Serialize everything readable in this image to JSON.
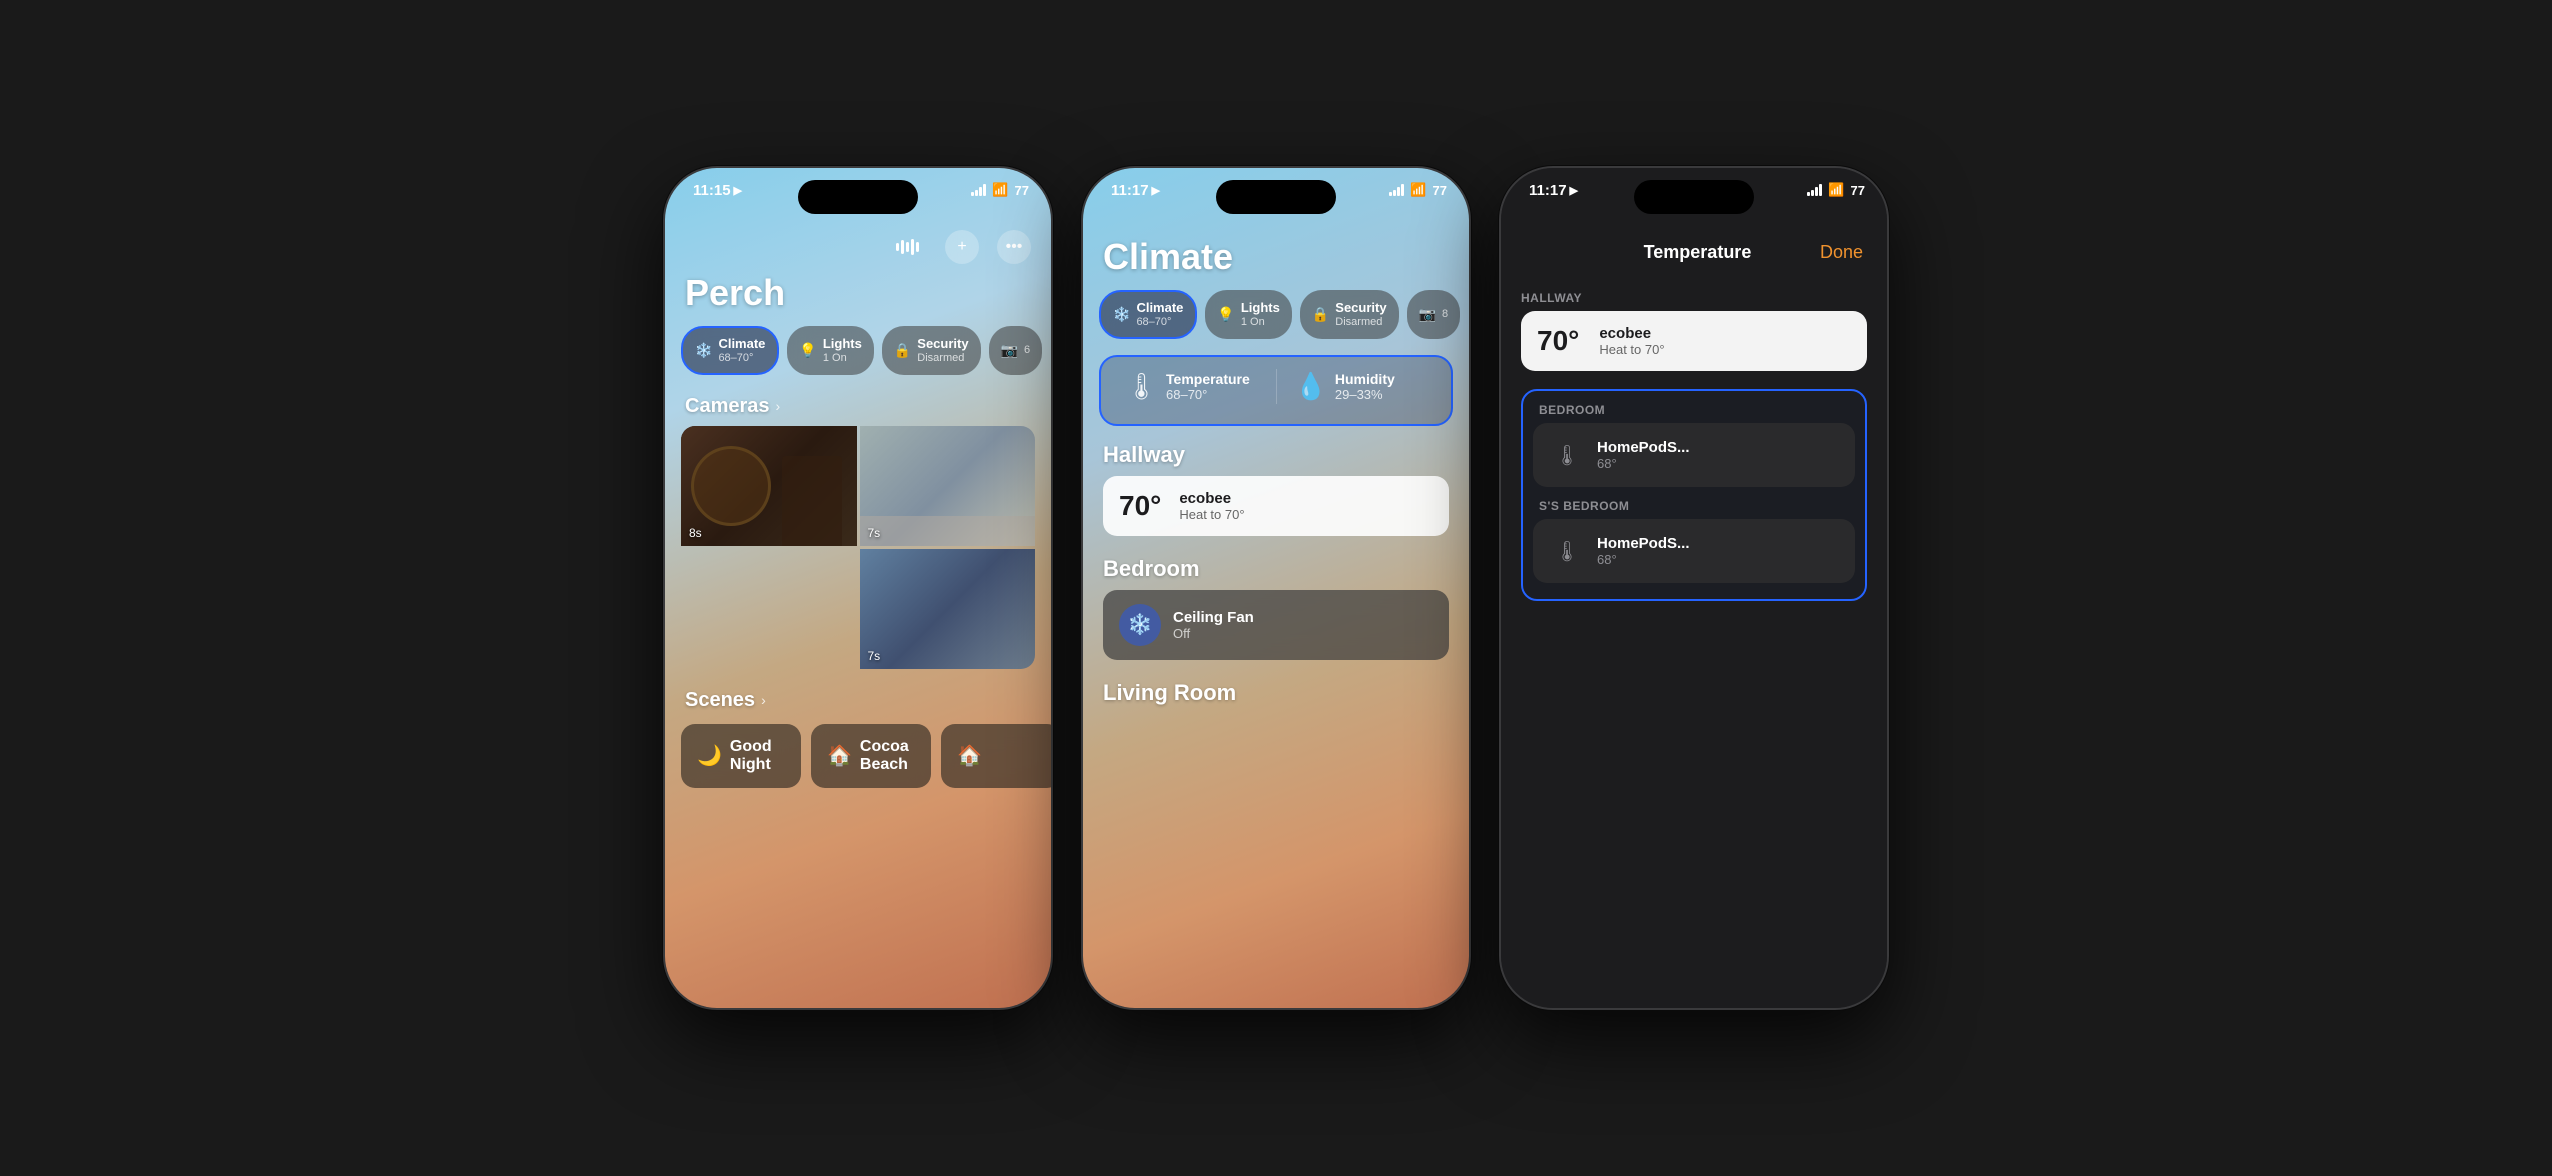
{
  "phone1": {
    "status_time": "11:15",
    "title": "Perch",
    "tabs": [
      {
        "label": "Climate",
        "sublabel": "68–70°",
        "icon": "❄️",
        "active": true
      },
      {
        "label": "Lights",
        "sublabel": "1 On",
        "icon": "💡",
        "active": false
      },
      {
        "label": "Security",
        "sublabel": "Disarmed",
        "icon": "🔒",
        "active": false
      },
      {
        "label": "",
        "sublabel": "6",
        "icon": "📷",
        "active": false
      }
    ],
    "cameras_label": "Cameras",
    "cameras": [
      {
        "timer": "8s"
      },
      {
        "timer": "7s"
      },
      {
        "timer": "7s"
      },
      {
        "timer": ""
      }
    ],
    "scenes_label": "Scenes",
    "scenes": [
      {
        "label": "Good Night",
        "icon": "🌙"
      },
      {
        "label": "Cocoa Beach",
        "icon": "🏠"
      }
    ]
  },
  "phone2": {
    "status_time": "11:17",
    "title": "Climate",
    "tabs": [
      {
        "label": "Climate",
        "sublabel": "68–70°",
        "icon": "❄️",
        "active": true
      },
      {
        "label": "Lights",
        "sublabel": "1 On",
        "icon": "💡",
        "active": false
      },
      {
        "label": "Security",
        "sublabel": "Disarmed",
        "icon": "🔒",
        "active": false
      },
      {
        "label": "",
        "sublabel": "8",
        "icon": "📷",
        "active": false
      }
    ],
    "subcards": [
      {
        "label": "Temperature",
        "value": "68–70°",
        "icon": "🌡"
      },
      {
        "label": "Humidity",
        "value": "29–33%",
        "icon": "💧"
      }
    ],
    "rooms": [
      {
        "name": "Hallway",
        "devices": [
          {
            "name": "ecobee",
            "status": "Heat to 70°",
            "temp": "70°",
            "type": "ecobee"
          }
        ]
      },
      {
        "name": "Bedroom",
        "devices": [
          {
            "name": "Ceiling Fan",
            "status": "Off",
            "type": "fan"
          }
        ]
      },
      {
        "name": "Living Room",
        "devices": []
      }
    ]
  },
  "phone3": {
    "status_time": "11:17",
    "page_title": "Temperature",
    "done_label": "Done",
    "hallway": {
      "section_label": "HALLWAY",
      "devices": [
        {
          "name": "ecobee",
          "status": "Heat to 70°",
          "temp": "70°"
        }
      ]
    },
    "bedroom": {
      "section_label": "BEDROOM",
      "devices": [
        {
          "name": "HomePodS...",
          "value": "68°"
        }
      ]
    },
    "s_bedroom": {
      "section_label": "S'S BEDROOM",
      "devices": [
        {
          "name": "HomePodS...",
          "value": "68°"
        }
      ]
    }
  }
}
